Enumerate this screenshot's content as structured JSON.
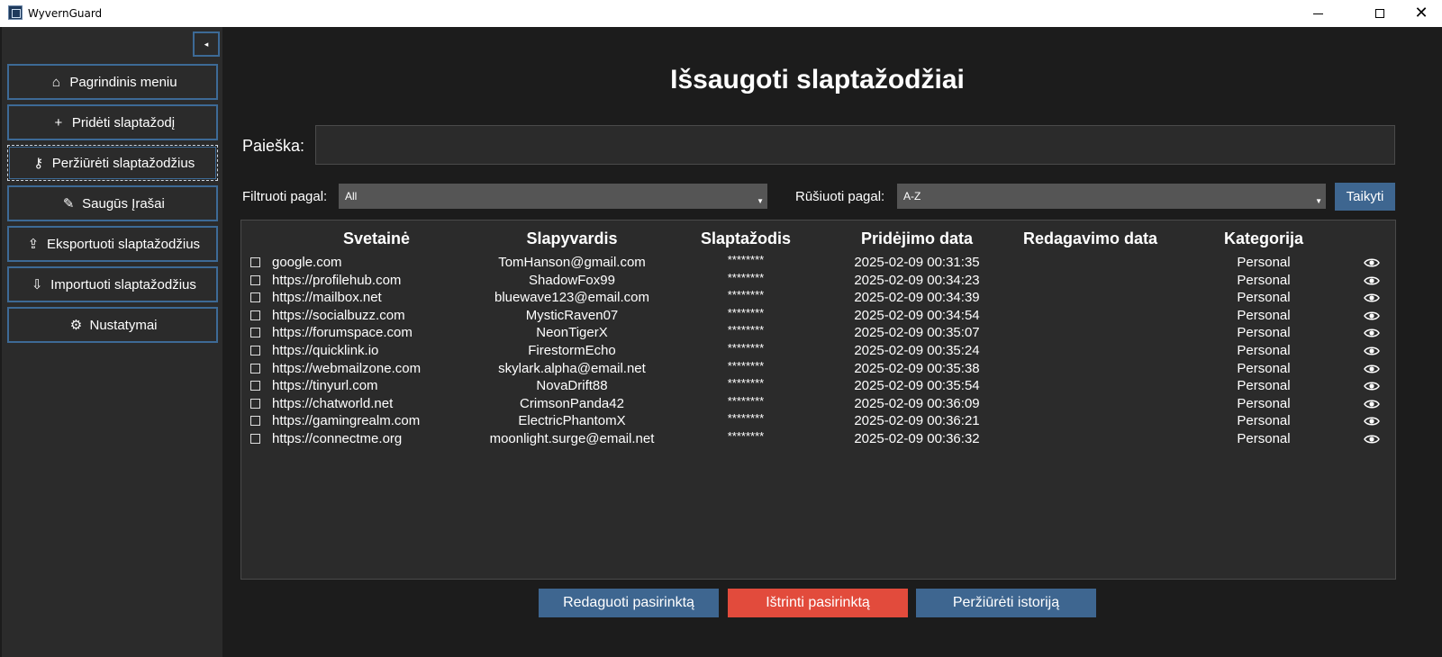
{
  "window": {
    "title": "WyvernGuard",
    "icon": "app-logo-icon",
    "controls": [
      "minimize-icon",
      "maximize-icon",
      "close-icon"
    ]
  },
  "sidebar": {
    "collapse_glyph": "◂",
    "items": [
      {
        "label": "Pagrindinis meniu",
        "icon": "home-icon",
        "glyph": "⌂"
      },
      {
        "label": "Pridėti slaptažodį",
        "icon": "plus-icon",
        "glyph": "+"
      },
      {
        "label": "Peržiūrėti slaptažodžius",
        "icon": "key-icon",
        "glyph": "⚷",
        "active": true
      },
      {
        "label": "Saugūs Įrašai",
        "icon": "note-icon",
        "glyph": "✎"
      },
      {
        "label": "Eksportuoti slaptažodžius",
        "icon": "export-icon",
        "glyph": "⇪"
      },
      {
        "label": "Importuoti slaptažodžius",
        "icon": "import-icon",
        "glyph": "⇩"
      },
      {
        "label": "Nustatymai",
        "icon": "gear-icon",
        "glyph": "⚙"
      }
    ]
  },
  "main": {
    "title": "Išsaugoti slaptažodžiai",
    "search": {
      "label": "Paieška:",
      "value": "",
      "placeholder": ""
    },
    "filter": {
      "label": "Filtruoti pagal:",
      "selected": "All"
    },
    "sort": {
      "label": "Rūšiuoti pagal:",
      "selected": "A-Z"
    },
    "apply_label": "Taikyti",
    "table": {
      "headers": [
        "Svetainė",
        "Slapyvardis",
        "Slaptažodis",
        "Pridėjimo data",
        "Redagavimo data",
        "Kategorija"
      ],
      "rows": [
        {
          "site": "google.com",
          "user": "TomHanson@gmail.com",
          "password": "********",
          "added": "2025-02-09 00:31:35",
          "edited": "",
          "category": "Personal"
        },
        {
          "site": "https://profilehub.com",
          "user": "ShadowFox99",
          "password": "********",
          "added": "2025-02-09 00:34:23",
          "edited": "",
          "category": "Personal"
        },
        {
          "site": "https://mailbox.net",
          "user": "bluewave123@email.com",
          "password": "********",
          "added": "2025-02-09 00:34:39",
          "edited": "",
          "category": "Personal"
        },
        {
          "site": "https://socialbuzz.com",
          "user": "MysticRaven07",
          "password": "********",
          "added": "2025-02-09 00:34:54",
          "edited": "",
          "category": "Personal"
        },
        {
          "site": "https://forumspace.com",
          "user": "NeonTigerX",
          "password": "********",
          "added": "2025-02-09 00:35:07",
          "edited": "",
          "category": "Personal"
        },
        {
          "site": "https://quicklink.io",
          "user": "FirestormEcho",
          "password": "********",
          "added": "2025-02-09 00:35:24",
          "edited": "",
          "category": "Personal"
        },
        {
          "site": "https://webmailzone.com",
          "user": "skylark.alpha@email.net",
          "password": "********",
          "added": "2025-02-09 00:35:38",
          "edited": "",
          "category": "Personal"
        },
        {
          "site": "https://tinyurl.com",
          "user": "NovaDrift88",
          "password": "********",
          "added": "2025-02-09 00:35:54",
          "edited": "",
          "category": "Personal"
        },
        {
          "site": "https://chatworld.net",
          "user": "CrimsonPanda42",
          "password": "********",
          "added": "2025-02-09 00:36:09",
          "edited": "",
          "category": "Personal"
        },
        {
          "site": "https://gamingrealm.com",
          "user": "ElectricPhantomX",
          "password": "********",
          "added": "2025-02-09 00:36:21",
          "edited": "",
          "category": "Personal"
        },
        {
          "site": "https://connectme.org",
          "user": "moonlight.surge@email.net",
          "password": "********",
          "added": "2025-02-09 00:36:32",
          "edited": "",
          "category": "Personal"
        }
      ]
    },
    "actions": {
      "edit_label": "Redaguoti pasirinktą",
      "delete_label": "Ištrinti pasirinktą",
      "history_label": "Peržiūrėti istoriją"
    }
  },
  "colors": {
    "accent": "#3e6690",
    "danger": "#e24b3c",
    "background": "#1c1c1c",
    "panel": "#2b2b2b",
    "border": "#3d6a96"
  }
}
